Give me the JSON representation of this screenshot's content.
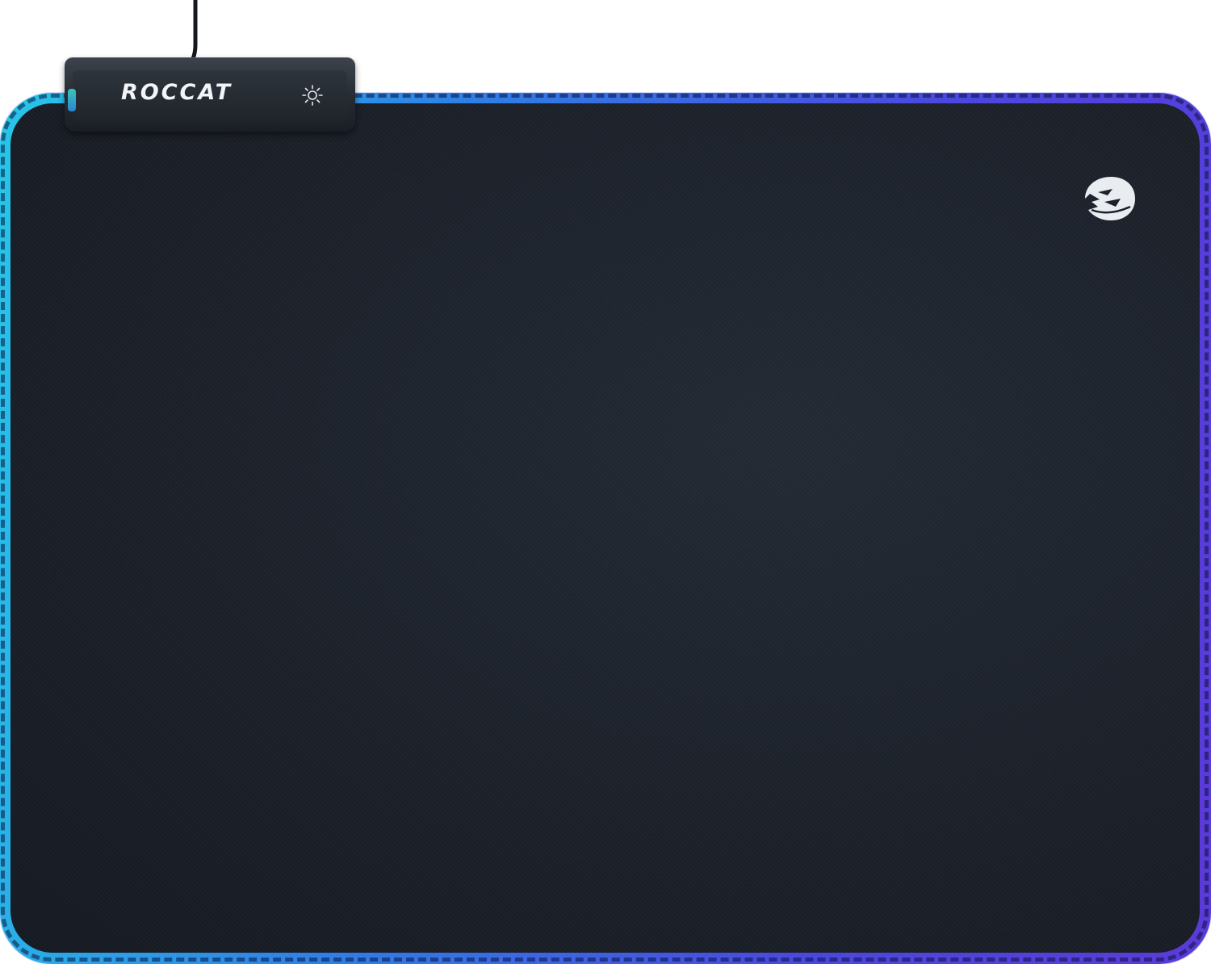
{
  "product": {
    "brand_text": "ROCCAT",
    "controls": {
      "brightness_button_icon": "brightness-sun-icon"
    },
    "logo_icon": "roccat-cat-head-icon",
    "colors": {
      "mat_surface": "#1b2029",
      "edge_rgb_start": "#27c6e8",
      "edge_rgb_mid": "#2f7fe6",
      "edge_rgb_end": "#5b3ad8",
      "hub_body": "#262b32",
      "logo": "#e9ecf0"
    }
  }
}
